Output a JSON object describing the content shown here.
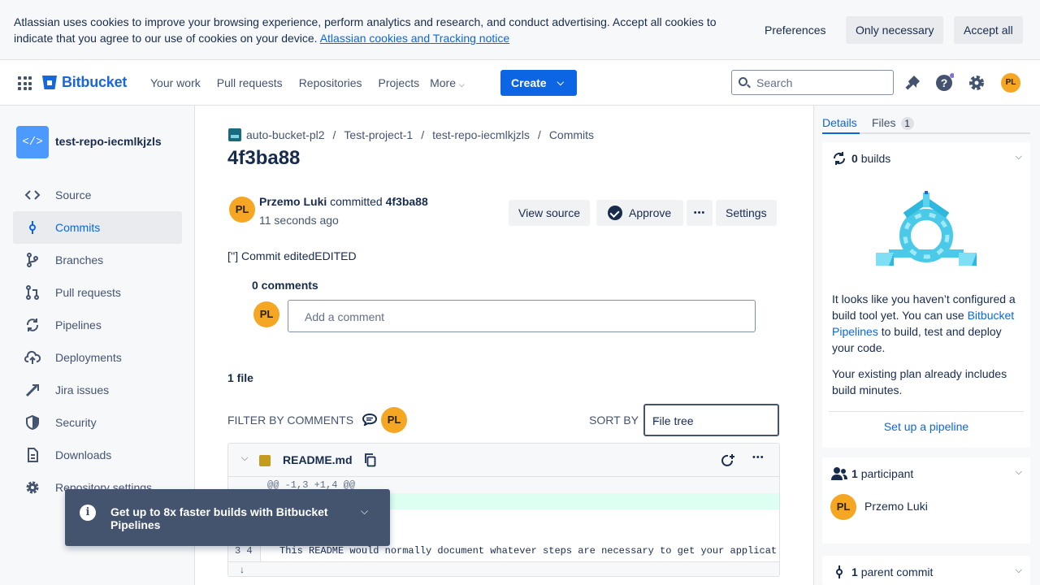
{
  "cookie_banner": {
    "text": "Atlassian uses cookies to improve your browsing experience, perform analytics and research, and conduct advertising. Accept all cookies to indicate that you agree to our use of cookies on your device.",
    "link": "Atlassian cookies and Tracking notice",
    "preferences": "Preferences",
    "only_necessary": "Only necessary",
    "accept_all": "Accept all"
  },
  "topnav": {
    "logo": "Bitbucket",
    "items": [
      "Your work",
      "Pull requests",
      "Repositories",
      "Projects",
      "More"
    ],
    "create": "Create",
    "search_placeholder": "Search",
    "avatar_initials": "PL"
  },
  "sidebar": {
    "repo_name": "test-repo-iecmlkjzls",
    "repo_icon": "</>",
    "items": [
      {
        "label": "Source",
        "icon": "code-icon"
      },
      {
        "label": "Commits",
        "icon": "commit-icon",
        "active": true
      },
      {
        "label": "Branches",
        "icon": "branch-icon"
      },
      {
        "label": "Pull requests",
        "icon": "pull-request-icon"
      },
      {
        "label": "Pipelines",
        "icon": "pipelines-icon"
      },
      {
        "label": "Deployments",
        "icon": "deployments-icon"
      },
      {
        "label": "Jira issues",
        "icon": "jira-icon"
      },
      {
        "label": "Security",
        "icon": "shield-icon"
      },
      {
        "label": "Downloads",
        "icon": "download-icon"
      },
      {
        "label": "Repository settings",
        "icon": "gear-icon"
      }
    ]
  },
  "main": {
    "breadcrumbs": [
      "auto-bucket-pl2",
      "Test-project-1",
      "test-repo-iecmlkjzls",
      "Commits"
    ],
    "title": "4f3ba88",
    "author": "Przemo Luki",
    "committed_word": "committed",
    "commit_hash": "4f3ba88",
    "time": "11 seconds ago",
    "avatar_initials": "PL",
    "buttons": {
      "view_source": "View source",
      "approve": "Approve",
      "more": "•••",
      "settings": "Settings"
    },
    "commit_message": "[''] Commit editedEDITED",
    "comments_header": "0 comments",
    "comment_placeholder": "Add a comment",
    "files_header": "1 file",
    "filter_label": "FILTER BY COMMENTS",
    "sort_label": "SORT BY",
    "sort_value": "File tree",
    "file": {
      "name": "README.md",
      "hunk": "@@ -1,3 +1,4 @@",
      "line_numbers": "3 4",
      "code_line": "This README would normally document whatever steps are necessary to get your applicat"
    }
  },
  "toast": {
    "text": "Get up to 8x faster builds with Bitbucket Pipelines"
  },
  "right_panel": {
    "tabs": {
      "details": "Details",
      "files": "Files",
      "files_count": "1"
    },
    "builds": {
      "count": "0",
      "label": "builds"
    },
    "pipeline_text_1": "It looks like you haven’t configured a build tool yet. You can use",
    "pipeline_link": "Bitbucket Pipelines",
    "pipeline_text_2": "to build, test and deploy your code.",
    "pipeline_text_3": "Your existing plan already includes build minutes.",
    "setup_link": "Set up a pipeline",
    "participants": {
      "count": "1",
      "label": "participant",
      "name": "Przemo Luki",
      "initials": "PL"
    },
    "parent": {
      "count": "1",
      "label": "parent commit"
    }
  },
  "colors": {
    "accent": "#0c66e4",
    "avatar": "#f5a623",
    "toast_bg": "#44546f",
    "added_line": "#dcfff1"
  }
}
